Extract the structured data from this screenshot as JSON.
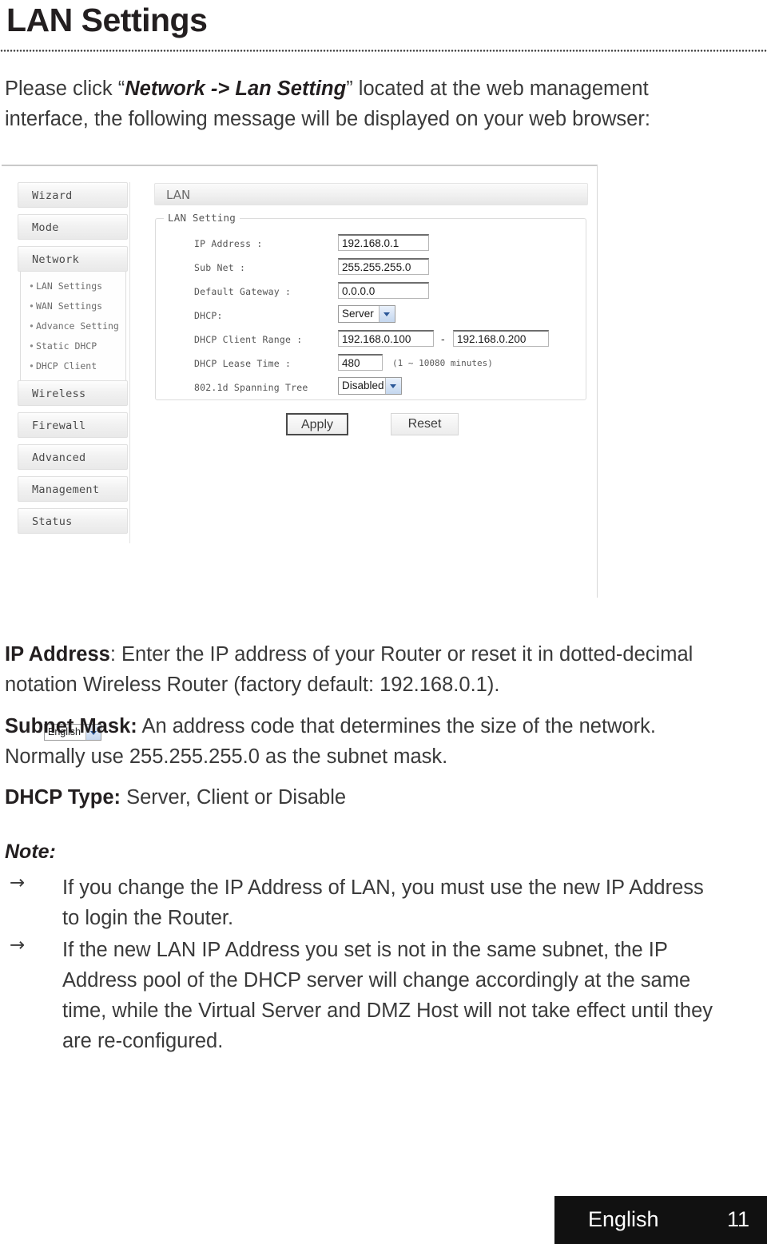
{
  "page": {
    "title": "LAN Settings",
    "intro_prefix": "Please click “",
    "intro_emphasis": "Network -> Lan Setting",
    "intro_suffix": "” located at the web management interface, the following message will be displayed on your web browser:"
  },
  "screenshot": {
    "sidebar": {
      "items": [
        {
          "label": "Wizard"
        },
        {
          "label": "Mode"
        },
        {
          "label": "Network"
        },
        {
          "label": "Wireless"
        },
        {
          "label": "Firewall"
        },
        {
          "label": "Advanced"
        },
        {
          "label": "Management"
        },
        {
          "label": "Status"
        }
      ],
      "network_submenu": [
        {
          "label": "LAN Settings"
        },
        {
          "label": "WAN Settings"
        },
        {
          "label": "Advance Setting"
        },
        {
          "label": "Static DHCP"
        },
        {
          "label": "DHCP Client"
        }
      ],
      "language_select": {
        "value": "English"
      }
    },
    "main": {
      "header": "LAN",
      "fieldset_legend": "LAN Setting",
      "fields": [
        {
          "label": "IP Address :",
          "value": "192.168.0.1"
        },
        {
          "label": "Sub Net :",
          "value": "255.255.255.0"
        },
        {
          "label": "Default Gateway :",
          "value": "0.0.0.0"
        },
        {
          "label": "DHCP:",
          "value": "Server"
        },
        {
          "label": "DHCP Client Range :",
          "value": "192.168.0.100",
          "value2": "192.168.0.200",
          "separator": "-"
        },
        {
          "label": "DHCP Lease Time :",
          "value": "480",
          "hint": "(1 ~ 10080 minutes)"
        },
        {
          "label": "802.1d Spanning Tree",
          "value": "Disabled"
        }
      ],
      "buttons": {
        "apply": "Apply",
        "reset": "Reset"
      }
    }
  },
  "descriptions": [
    {
      "term": "IP Address",
      "separator": ": ",
      "text": "Enter the IP address of your Router or reset it in dotted-decimal notation Wireless Router (factory default: 192.168.0.1)."
    },
    {
      "term": "Subnet Mask:",
      "separator": " ",
      "text": "An address code that determines the size of the network. Normally use 255.255.255.0 as the subnet mask."
    },
    {
      "term": "DHCP Type:",
      "separator": " ",
      "text": "Server, Client or Disable"
    }
  ],
  "note": {
    "heading": "Note:",
    "arrow": "→",
    "items": [
      "If you change the IP Address of LAN, you must use the new IP Address to login the Router.",
      "If the new LAN IP Address you set is not in the same subnet, the IP Address pool of the DHCP server will change accordingly at the same time, while the Virtual Server and DMZ Host will not take effect until they are re-configured."
    ]
  },
  "footer": {
    "language": "English",
    "page_number": "11"
  }
}
